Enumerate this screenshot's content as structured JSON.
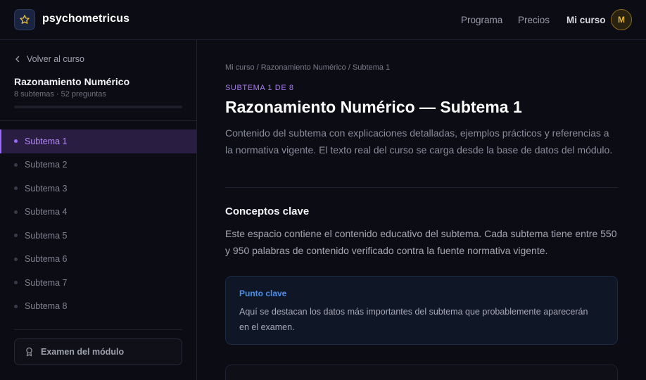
{
  "brand": {
    "name": "psychometricus",
    "logo_icon": "star-icon"
  },
  "nav": {
    "links": [
      "Programa",
      "Precios",
      "Mi curso"
    ],
    "avatar_initial": "M"
  },
  "sidebar": {
    "back_label": "Volver al curso",
    "module_title": "Razonamiento Numérico",
    "module_meta": "8 subtemas · 52 preguntas",
    "progress": 0,
    "items": [
      {
        "label": "Subtema 1",
        "active": true
      },
      {
        "label": "Subtema 2",
        "active": false
      },
      {
        "label": "Subtema 3",
        "active": false
      },
      {
        "label": "Subtema 4",
        "active": false
      },
      {
        "label": "Subtema 5",
        "active": false
      },
      {
        "label": "Subtema 6",
        "active": false
      },
      {
        "label": "Subtema 7",
        "active": false
      },
      {
        "label": "Subtema 8",
        "active": false
      }
    ],
    "exam_label": "Examen del módulo"
  },
  "main": {
    "breadcrumb": "Mi curso / Razonamiento Numérico / Subtema 1",
    "eyebrow": "SUBTEMA 1 DE 8",
    "title": "Razonamiento Numérico — Subtema 1",
    "lead": "Contenido del subtema con explicaciones detalladas, ejemplos prácticos y referencias a la normativa vigente. El texto real del curso se carga desde la base de datos del módulo.",
    "section_title": "Conceptos clave",
    "section_text": "Este espacio contiene el contenido educativo del subtema. Cada subtema tiene entre 550 y 950 palabras de contenido verificado contra la fuente normativa vigente.",
    "callout": {
      "title": "Punto clave",
      "text": "Aquí se destacan los datos más importantes del subtema que probablemente aparecerán en el examen."
    }
  },
  "colors": {
    "accent": "#8b5cf6",
    "callout_accent": "#4d8fe8",
    "avatar": "#e5b440"
  }
}
